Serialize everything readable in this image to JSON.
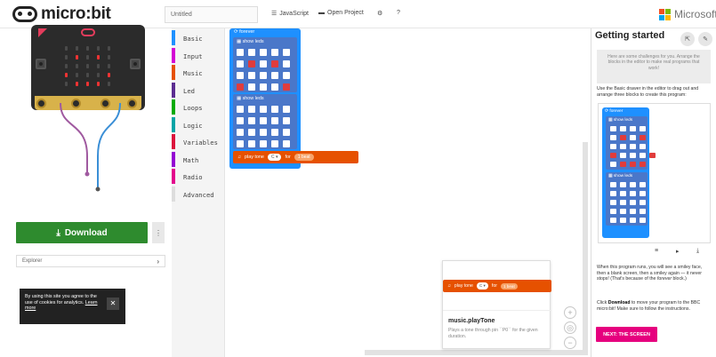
{
  "header": {
    "logo_text": "micro:bit",
    "project_name": "Untitled",
    "javascript_label": "JavaScript",
    "open_project_label": "Open Project",
    "settings_icon": "gear-icon",
    "help_label": "?",
    "microsoft_label": "Microsoft",
    "microsoft_colors": [
      "#f25022",
      "#7fba00",
      "#00a4ef",
      "#ffb900"
    ]
  },
  "simulator": {
    "download_label": "Download",
    "more_label": "⋮",
    "explorer_label": "Explorer",
    "explorer_chevron": "›"
  },
  "cookie_banner": {
    "text": "By using this site you agree to the use of cookies for analytics.",
    "link": "Learn more",
    "close": "✕"
  },
  "toolbox": {
    "categories": [
      {
        "label": "Basic",
        "color": "#1e90ff"
      },
      {
        "label": "Input",
        "color": "#d400d4"
      },
      {
        "label": "Music",
        "color": "#e65100"
      },
      {
        "label": "Led",
        "color": "#5c2d91"
      },
      {
        "label": "Loops",
        "color": "#00aa00"
      },
      {
        "label": "Logic",
        "color": "#00a4a6"
      },
      {
        "label": "Variables",
        "color": "#dc143c"
      },
      {
        "label": "Math",
        "color": "#9400d3"
      },
      {
        "label": "Radio",
        "color": "#e3008c"
      },
      {
        "label": "Advanced",
        "color": "#dddddd"
      }
    ]
  },
  "workspace": {
    "forever_label": "forever",
    "show_leds_label": "show leds",
    "play_tone_label": "play tone",
    "tone_value": "C",
    "for_label": "for",
    "beat_value": "1",
    "beat_unit": "beat",
    "smiley_on_cells": [
      6,
      8,
      15,
      19,
      21,
      22,
      23
    ],
    "tooltip": {
      "title": "music.playTone",
      "description": "Plays a tone through pin ``P0`` for the given duration."
    },
    "zoom_in": "+",
    "zoom_out": "−"
  },
  "tutorial": {
    "title": "Getting started",
    "challenge_text": "Here are some challenges for you. Arrange the blocks in the editor to make real programs that work!",
    "instruction_text": "Use the Basic drawer in the editor to drag out and arrange three blocks to create this program:",
    "basic_word": "Basic",
    "result_text": "When this program runs, you will see a smiley face, then a blank screen, then a smiley again — it never stops! (That's because of the",
    "forever_word": "forever",
    "result_tail": "block.)",
    "download_text_1": "Click",
    "download_word": "Download",
    "download_text_2": "to move your program to the BBC micro:bit! Make sure to follow the instructions.",
    "next_label": "NEXT: THE SCREEN",
    "tools": [
      "≡",
      "▸",
      "⤓"
    ]
  }
}
